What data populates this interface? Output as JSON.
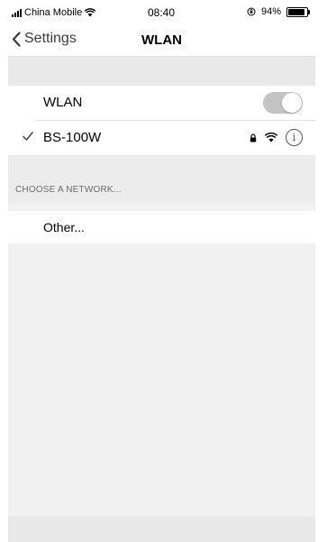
{
  "status_bar": {
    "carrier": "China Mobile",
    "time": "08:40",
    "battery": "94%"
  },
  "nav": {
    "back_label": "Settings",
    "title": "WLAN"
  },
  "wlan_toggle": {
    "label": "WLAN",
    "on": true
  },
  "connected_network": {
    "name": "BS-100W",
    "info_glyph": "i",
    "icons": [
      "checkmark-icon",
      "lock-icon",
      "wifi-icon",
      "info-icon"
    ]
  },
  "section_header": "CHOOSE A NETWORK...",
  "other_network": "Other..."
}
